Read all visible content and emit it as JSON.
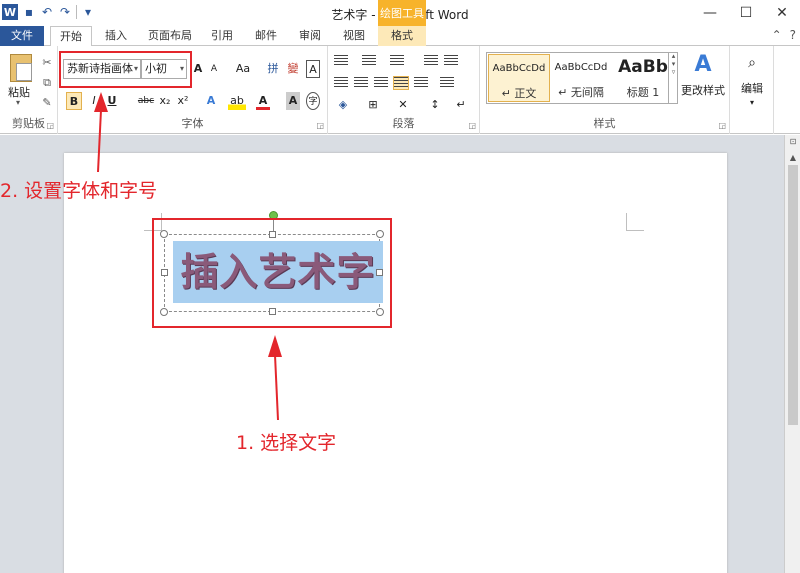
{
  "titlebar": {
    "title": "艺术字 - Microsoft Word",
    "context_tools": "绘图工具",
    "logo": "W",
    "qat_icons": [
      "save-icon",
      "undo-icon",
      "redo-icon",
      "customize-icon"
    ],
    "window_controls": [
      "—",
      "☐",
      "✕"
    ]
  },
  "tabs": {
    "file": "文件",
    "home": "开始",
    "insert": "插入",
    "layout": "页面布局",
    "references": "引用",
    "mailings": "邮件",
    "review": "审阅",
    "view": "视图",
    "format": "格式"
  },
  "ribbon": {
    "clipboard": {
      "paste": "粘贴",
      "label": "剪贴板"
    },
    "font": {
      "font_name": "苏新诗指画体",
      "font_size": "小初",
      "grow": "A",
      "shrink": "A",
      "change_case": "Aa",
      "bold": "B",
      "italic": "I",
      "underline": "U",
      "strike": "abc",
      "subscript": "x₂",
      "superscript": "x²",
      "label": "字体"
    },
    "paragraph": {
      "label": "段落"
    },
    "styles": {
      "items": [
        {
          "sample": "AaBbCcDd",
          "name": "↵ 正文"
        },
        {
          "sample": "AaBbCcDd",
          "name": "↵ 无间隔"
        },
        {
          "sample": "AaBb",
          "name": "标题 1"
        }
      ],
      "change_styles": "更改样式",
      "label": "样式"
    },
    "editing": {
      "label": "编辑"
    }
  },
  "document": {
    "wordart_text": "插入艺术字"
  },
  "annotations": {
    "step1": "1. 选择文字",
    "step2": "2. 设置字体和字号"
  },
  "colors": {
    "accent": "#2b579a",
    "annotation_red": "#e3262c",
    "selection_blue": "#a8cff0",
    "context_orange": "#f7b32b"
  }
}
